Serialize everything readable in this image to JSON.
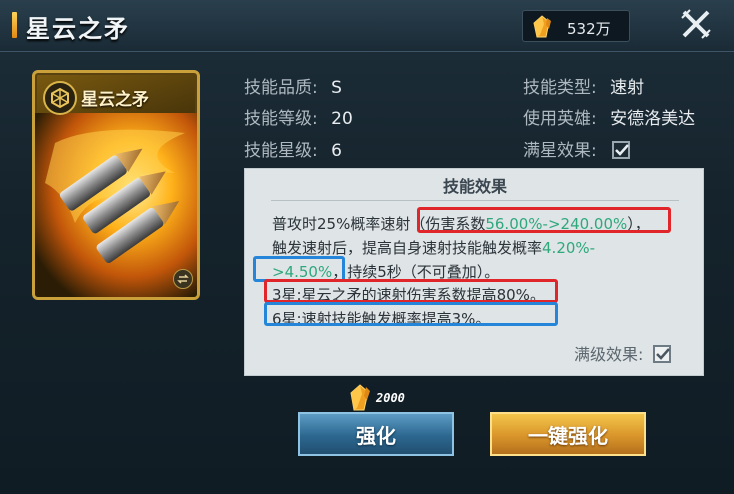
{
  "header": {
    "title": "星云之矛",
    "currency_value": "532万"
  },
  "card": {
    "title": "星云之矛"
  },
  "info": {
    "quality_label": "技能品质:",
    "quality_value": "S",
    "level_label": "技能等级:",
    "level_value": "20",
    "star_label": "技能星级:",
    "star_value": "6",
    "type_label": "技能类型:",
    "type_value": "速射",
    "hero_label": "使用英雄:",
    "hero_value": "安德洛美达",
    "max_star_label": "满星效果:",
    "max_star_checked": true
  },
  "effect": {
    "title": "技能效果",
    "line1_prefix": "普攻时25%概率速射（伤害系数",
    "line1_green": "56.00%->240.00%",
    "line1_suffix": "），",
    "line2_prefix": "触发速射后，提高自身速射技能触发概率",
    "line2_green": "4.20%-",
    "line3_green": ">4.50%",
    "line3_suffix": "，持续5秒（不可叠加）。",
    "star3": "3星:星云之矛的速射伤害系数提高80%。",
    "star6": "6星:速射技能触发概率提高3%。",
    "max_level_label": "满级效果:",
    "max_level_checked": true
  },
  "cost": {
    "value": "2000"
  },
  "buttons": {
    "upgrade": "强化",
    "upgrade_all": "一键强化"
  },
  "colors": {
    "accent_gold": "#e9a825",
    "green_value": "#2fa87c",
    "highlight_red": "#e0262a",
    "highlight_blue": "#2586d9"
  }
}
